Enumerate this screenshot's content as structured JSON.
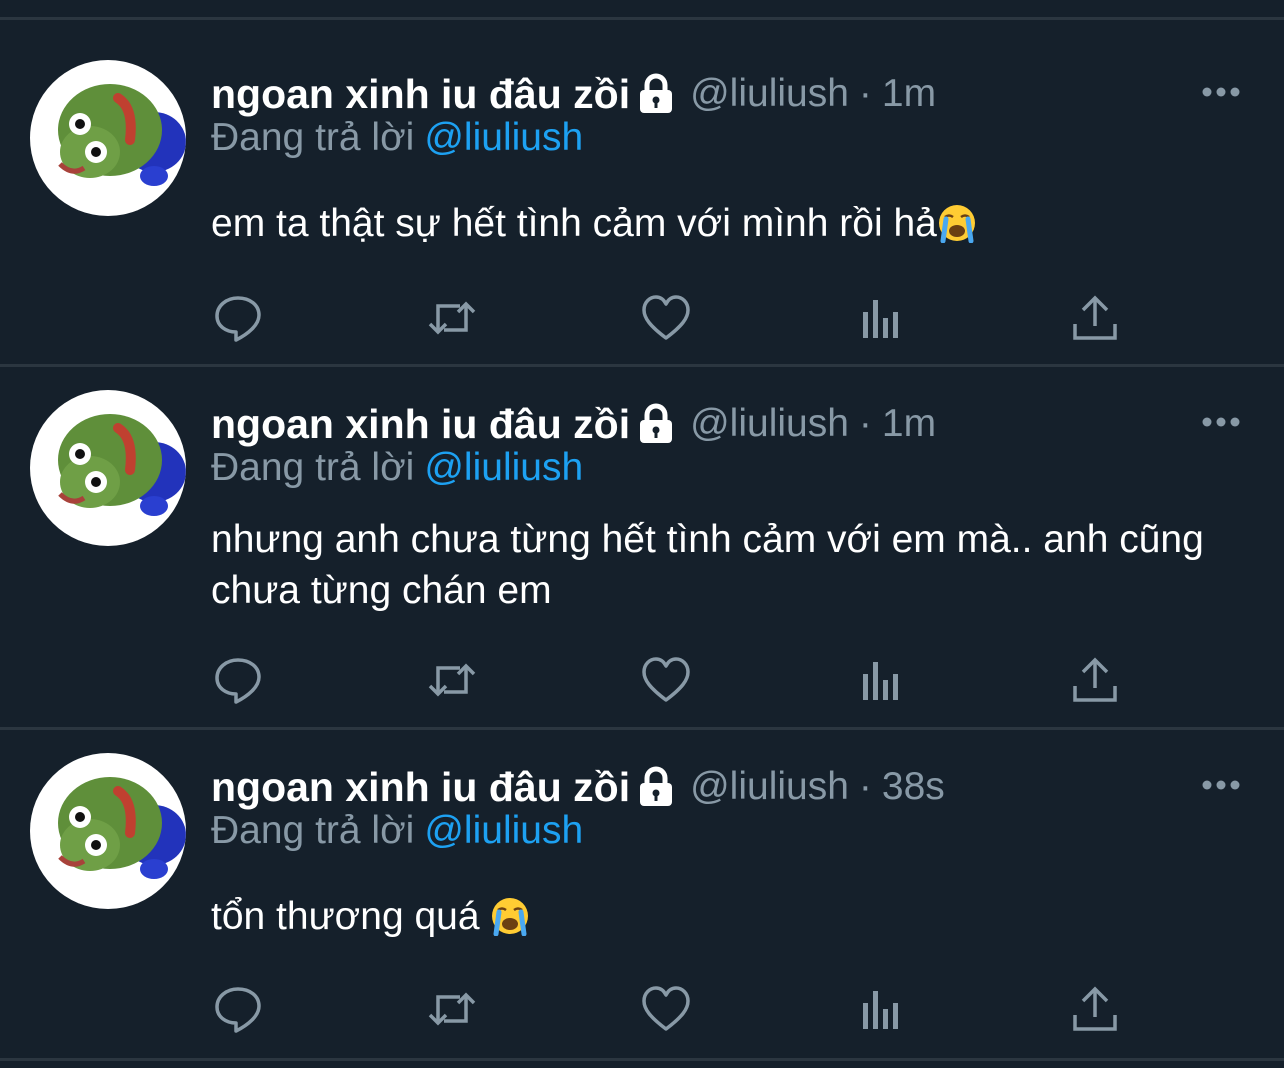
{
  "theme": {
    "background": "#15202b",
    "divider": "#2b3640",
    "text_primary": "#ffffff",
    "text_secondary": "#8899a6",
    "accent": "#1da1f2"
  },
  "tweets": [
    {
      "display_name": "ngoan xinh iu đâu zồi",
      "handle": "@liuliush",
      "separator": "·",
      "time": "1m",
      "reply_prefix": "Đang trả lời",
      "reply_to": "@liuliush",
      "text": "em ta thật sự hết tình cảm với mình rồi hả",
      "emoji": "loudly-crying-face-emoji",
      "icons": [
        "lock-icon",
        "more-icon",
        "reply-icon",
        "retweet-icon",
        "like-icon",
        "analytics-icon",
        "share-icon"
      ]
    },
    {
      "display_name": "ngoan xinh iu đâu zồi",
      "handle": "@liuliush",
      "separator": "·",
      "time": "1m",
      "reply_prefix": "Đang trả lời",
      "reply_to": "@liuliush",
      "text": "nhưng anh chưa từng hết tình cảm với em mà.. anh cũng chưa từng chán em",
      "emoji": "",
      "icons": [
        "lock-icon",
        "more-icon",
        "reply-icon",
        "retweet-icon",
        "like-icon",
        "analytics-icon",
        "share-icon"
      ]
    },
    {
      "display_name": "ngoan xinh iu đâu zồi",
      "handle": "@liuliush",
      "separator": "·",
      "time": "38s",
      "reply_prefix": "Đang trả lời",
      "reply_to": "@liuliush",
      "text": "tổn thương quá ",
      "emoji": "loudly-crying-face-emoji",
      "icons": [
        "lock-icon",
        "more-icon",
        "reply-icon",
        "retweet-icon",
        "like-icon",
        "analytics-icon",
        "share-icon"
      ]
    }
  ]
}
